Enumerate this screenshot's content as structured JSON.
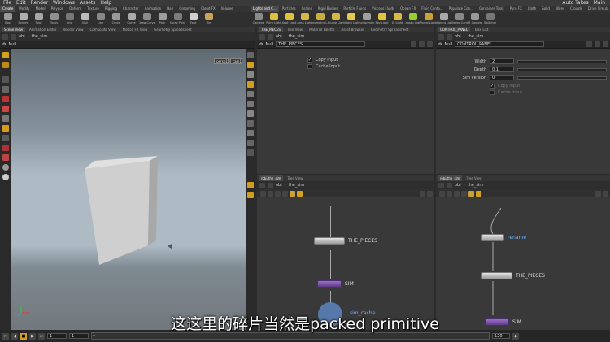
{
  "menu": {
    "items": [
      "File",
      "Edit",
      "Render",
      "Windows",
      "Assets",
      "Help"
    ],
    "right": [
      "Auto Takes",
      "Main"
    ]
  },
  "shelf_tabs_left": [
    "Create",
    "Modify",
    "Model",
    "Polygon",
    "Deform",
    "Texture",
    "Rigging",
    "Character",
    "Animation",
    "Hair",
    "Grooming",
    "Cloud FX",
    "Volume"
  ],
  "shelf_tools_left": [
    {
      "label": "Box",
      "color": "#9a9a9a"
    },
    {
      "label": "Sphere",
      "color": "#b0b0b0"
    },
    {
      "label": "Tube",
      "color": "#a7a7a7"
    },
    {
      "label": "Torus",
      "color": "#8f8f8f"
    },
    {
      "label": "Grid",
      "color": "#777"
    },
    {
      "label": "Null",
      "color": "#bbb"
    },
    {
      "label": "Line",
      "color": "#888"
    },
    {
      "label": "Circle",
      "color": "#999"
    },
    {
      "label": "Curve",
      "color": "#aaa"
    },
    {
      "label": "Draw Curve",
      "color": "#8b8b8b"
    },
    {
      "label": "Path",
      "color": "#9e9e9e"
    },
    {
      "label": "Spray Paint",
      "color": "#7c7c7c"
    },
    {
      "label": "Font",
      "color": "#cfcfcf"
    },
    {
      "label": "File",
      "color": "#c9a35a"
    }
  ],
  "shelf_tabs_right": [
    "Lights and C...",
    "Particles",
    "Grains",
    "Rigid Bodies",
    "Particle Fluids",
    "Viscous Fluids",
    "Ocean FX",
    "Fluid Conta...",
    "Populate Con...",
    "Container Tools",
    "Pyro FX",
    "Cloth",
    "Solid",
    "Wires",
    "Crowds",
    "Drive Simula..."
  ],
  "shelf_tools_right": [
    {
      "label": "Camera",
      "color": "#8a8a8a"
    },
    {
      "label": "Point Light",
      "color": "#e0c040"
    },
    {
      "label": "Spot Light",
      "color": "#e0c040"
    },
    {
      "label": "Area Light",
      "color": "#d6b84a"
    },
    {
      "label": "Geometry L...",
      "color": "#c9ad44"
    },
    {
      "label": "Volume Light",
      "color": "#d4b64b"
    },
    {
      "label": "Distant Light",
      "color": "#e6c84c"
    },
    {
      "label": "Environment",
      "color": "#a0a0a0"
    },
    {
      "label": "Sky Light",
      "color": "#e3c241"
    },
    {
      "label": "GI Light",
      "color": "#d8bb47"
    },
    {
      "label": "Caustic Light",
      "color": "#9acd32"
    },
    {
      "label": "Portal Light",
      "color": "#c9a23a"
    },
    {
      "label": "Ambient Lig...",
      "color": "#aaa"
    },
    {
      "label": "Stereo Cam",
      "color": "#888"
    },
    {
      "label": "VR Camera",
      "color": "#999"
    },
    {
      "label": "Switcher",
      "color": "#777"
    }
  ],
  "viewport": {
    "tabs": [
      "Scene View",
      "Animation Editor",
      "Render View",
      "Composite View",
      "Motion FX View",
      "Geometry Spreadsheet"
    ],
    "path": {
      "context": "obj",
      "node": "the_sim"
    },
    "header": "Null",
    "persp": "persp1",
    "cam": "cam1"
  },
  "panel_params1": {
    "tabs": [
      "THE_PIECES",
      "Tree View",
      "Material Palette",
      "Asset Browser",
      "Geometry Spreadsheet"
    ],
    "path": {
      "context": "obj",
      "node": "the_sim"
    },
    "node_type": "Null",
    "node_name": "THE_PIECES",
    "copy_input": "Copy Input",
    "cache_input": "Cache Input"
  },
  "panel_params2": {
    "tabs": [
      "CONTROL_PANEL",
      "Take List"
    ],
    "path": {
      "context": "obj",
      "node": "the_sim"
    },
    "node_type": "Null",
    "node_name": "CONTROL_PANEL",
    "width_label": "Width",
    "width_value": "2",
    "depth_label": "Depth",
    "depth_value": "0.1",
    "sim_label": "Sim version",
    "sim_value": "0",
    "copy_input": "Copy Input",
    "cache_input": "Cache Input"
  },
  "net1": {
    "tabs": [
      "/obj/the_sim",
      "Tree View"
    ],
    "path": {
      "context": "obj",
      "node": "the_sim"
    },
    "nodes": {
      "pieces": "THE_PIECES",
      "sim": "SIM",
      "cache": "sim_cache"
    }
  },
  "net2": {
    "tabs": [
      "/obj/the_sim",
      "Tree View"
    ],
    "path": {
      "context": "obj",
      "node": "the_sim"
    },
    "nodes": {
      "rename": "rename",
      "pieces": "THE_PIECES",
      "sim": "SIM"
    }
  },
  "subtitle": "这这里的碎片当然是packed primitive",
  "timeline": {
    "frame": "1",
    "start": "1",
    "mark": "1",
    "end": "120"
  }
}
